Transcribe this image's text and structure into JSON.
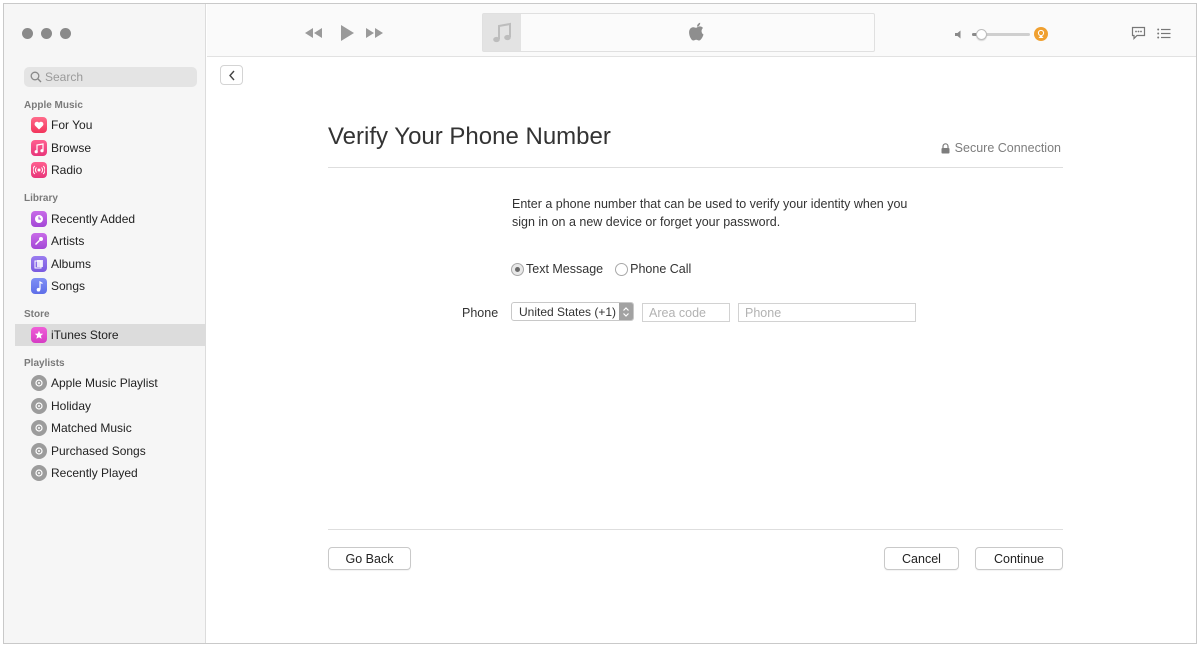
{
  "search": {
    "placeholder": "Search"
  },
  "sidebar": {
    "sections": [
      {
        "heading": "Apple Music",
        "items": [
          {
            "label": "For You",
            "icon": "heart-icon"
          },
          {
            "label": "Browse",
            "icon": "music-note-icon"
          },
          {
            "label": "Radio",
            "icon": "radio-icon"
          }
        ]
      },
      {
        "heading": "Library",
        "items": [
          {
            "label": "Recently Added",
            "icon": "clock-icon"
          },
          {
            "label": "Artists",
            "icon": "microphone-icon"
          },
          {
            "label": "Albums",
            "icon": "album-icon"
          },
          {
            "label": "Songs",
            "icon": "music-note-icon"
          }
        ]
      },
      {
        "heading": "Store",
        "items": [
          {
            "label": "iTunes Store",
            "icon": "star-icon",
            "selected": true
          }
        ]
      },
      {
        "heading": "Playlists",
        "items": [
          {
            "label": "Apple Music Playlist",
            "icon": "gear-icon"
          },
          {
            "label": "Holiday",
            "icon": "gear-icon"
          },
          {
            "label": "Matched Music",
            "icon": "gear-icon"
          },
          {
            "label": "Purchased Songs",
            "icon": "gear-icon"
          },
          {
            "label": "Recently Played",
            "icon": "gear-icon"
          }
        ]
      }
    ]
  },
  "main": {
    "title": "Verify Your Phone Number",
    "secure_label": "Secure Connection",
    "description": "Enter a phone number that can be used to verify your identity when you sign in on a new device or forget your password.",
    "options": {
      "text_message": "Text Message",
      "phone_call": "Phone Call",
      "selected": "text_message"
    },
    "phone_label": "Phone",
    "country": "United States (+1)",
    "area_code_placeholder": "Area code",
    "phone_placeholder": "Phone",
    "buttons": {
      "go_back": "Go Back",
      "cancel": "Cancel",
      "continue": "Continue"
    }
  },
  "colors": {
    "accent_orange": "#f0a030",
    "selected_row": "#dcdcdc"
  }
}
